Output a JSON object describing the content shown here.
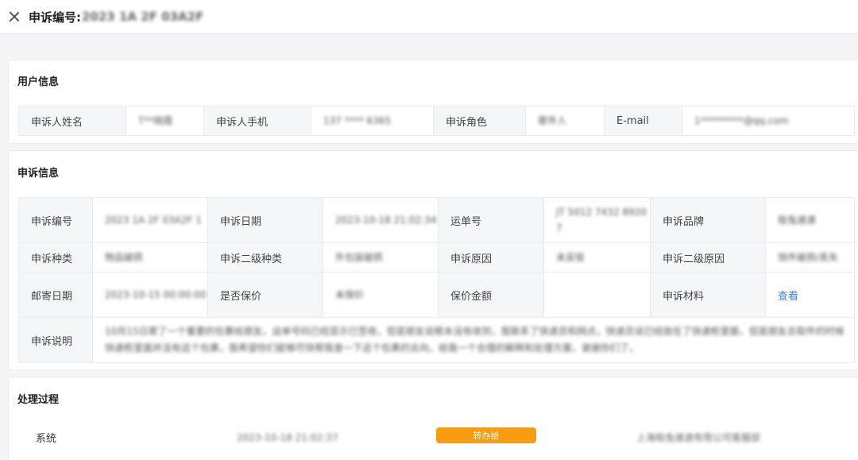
{
  "header": {
    "title": "申诉编号:",
    "appeal_no": "2023 1A 2F 03A2F"
  },
  "user_info": {
    "title": "用户信息",
    "name_label": "申诉人姓名",
    "name_value": "T**晓霞",
    "phone_label": "申诉人手机",
    "phone_value": "137 **** 6365",
    "role_label": "申诉角色",
    "role_value": "寄件人",
    "email_label": "E-mail",
    "email_value": "1*********@qq.com"
  },
  "appeal_info": {
    "title": "申诉信息",
    "rows": [
      [
        {
          "label": "申诉编号",
          "value": "2023 1A 2F 03A2F 1"
        },
        {
          "label": "申诉日期",
          "value": "2023-10-18 21:02:34"
        },
        {
          "label": "运单号",
          "value": "JT 5012 7432 8920 7"
        },
        {
          "label": "申诉品牌",
          "value": "极兔速递"
        }
      ],
      [
        {
          "label": "申诉种类",
          "value": "物品破损"
        },
        {
          "label": "申诉二级种类",
          "value": "外包装破损"
        },
        {
          "label": "申诉原因",
          "value": "未妥投"
        },
        {
          "label": "申诉二级原因",
          "value": "快件破损/丢失"
        }
      ],
      [
        {
          "label": "邮寄日期",
          "value": "2023-10-15 00:00:00"
        },
        {
          "label": "是否保价",
          "value": "未保价"
        },
        {
          "label": "保价金额",
          "value": ""
        },
        {
          "label": "申诉材料",
          "value": "查看"
        }
      ]
    ],
    "desc_label": "申诉说明",
    "desc_value": "10月15日寄了一个重要的包裹给朋友，运单号码已经显示已签收，但是朋友说根本没有收到，我联系了快递员和网点，快递员说已经放在了快递柜里面，但是朋友去取件的时候快递柜里面并没有这个包裹，我希望你们能够尽快帮我查一下这个包裹的去向，给我一个合理的解释和处理方案，谢谢你们了。"
  },
  "process": {
    "title": "处理过程",
    "rows": [
      {
        "name": "系统",
        "time": "2023-10-18 21:02:37",
        "action": "转办给",
        "target": "上海极兔速递有限公司客服部"
      }
    ]
  }
}
